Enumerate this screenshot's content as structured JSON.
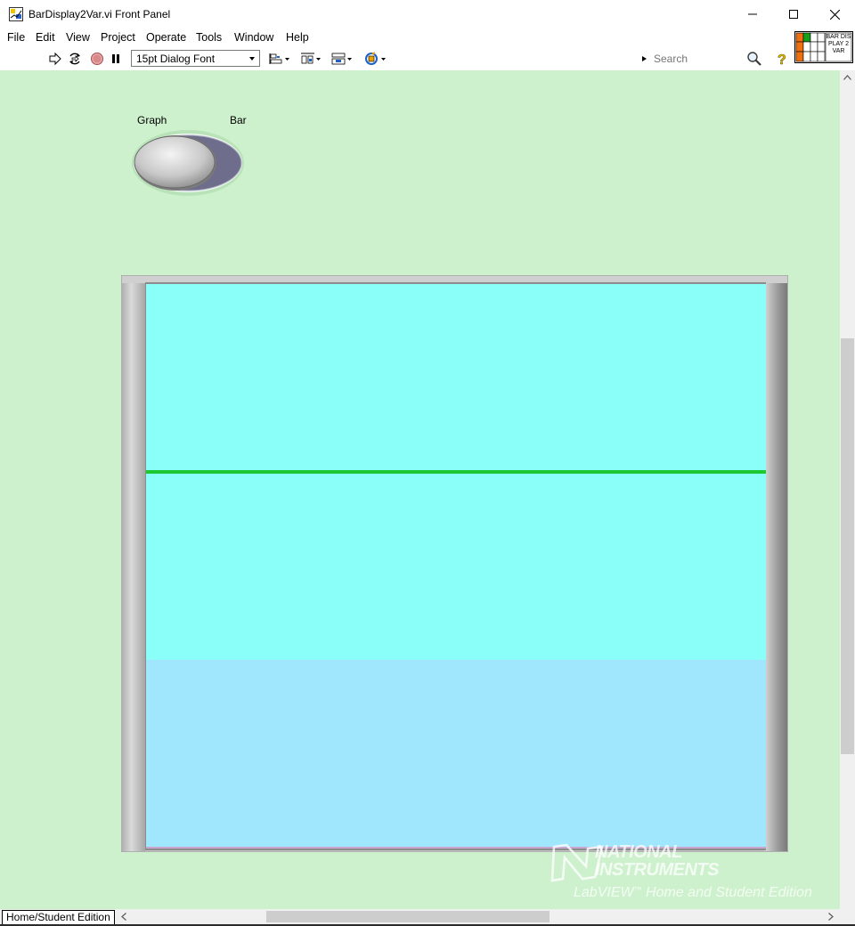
{
  "window": {
    "title": "BarDisplay2Var.vi Front Panel",
    "controls": [
      "minimize-icon",
      "maximize-icon",
      "close-icon"
    ]
  },
  "menu": {
    "items": [
      "File",
      "Edit",
      "View",
      "Project",
      "Operate",
      "Tools",
      "Window",
      "Help"
    ]
  },
  "toolbar": {
    "font_value": "15pt Dialog Font",
    "search_placeholder": "Search",
    "icons": [
      "run-arrow-icon",
      "run-continuously-icon",
      "abort-icon",
      "pause-icon",
      "align-objects-icon",
      "distribute-objects-icon",
      "resize-objects-icon",
      "reorder-icon",
      "search-icon",
      "help-icon"
    ]
  },
  "vi_icon": {
    "text": "BAR DISPLAY 2 VAR"
  },
  "front_panel": {
    "toggle": {
      "left_label": "Graph",
      "right_label": "Bar",
      "state": "Graph"
    },
    "graph": {
      "background_top": "#8afef9",
      "background_bottom": "#a0e6fc",
      "line_color": "#1ec832"
    }
  },
  "status": {
    "edition": "Home/Student Edition"
  },
  "watermark": {
    "brand_line1": "NATIONAL",
    "brand_line2": "INSTRUMENTS",
    "product": "LabVIEW",
    "edition": "Home and Student Edition"
  },
  "colors": {
    "panel_bg": "#cef1cd",
    "scroll_bg": "#f0f0f0"
  }
}
